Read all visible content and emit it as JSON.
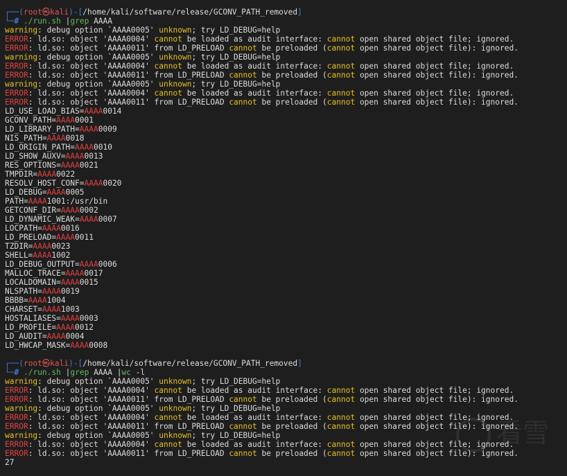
{
  "terminal": {
    "lines": [
      {
        "kind": "prompt",
        "user": "root",
        "host": "kali",
        "path": "/home/kali/software/release/GCONV_PATH_removed"
      },
      {
        "kind": "cmd",
        "segments": [
          {
            "t": "./run.sh",
            "c": "cmd"
          },
          {
            "t": " ",
            "c": "txt"
          },
          {
            "t": "|",
            "c": "pipe"
          },
          {
            "t": "grep",
            "c": "grep"
          },
          {
            "t": " AAAA",
            "c": "arg"
          }
        ]
      },
      {
        "kind": "warn",
        "segments": [
          {
            "t": "warning",
            "c": "yel"
          },
          {
            "t": ": debug option `AAAA0005' ",
            "c": "txt"
          },
          {
            "t": "unknown",
            "c": "yel"
          },
          {
            "t": "; try LD_DEBUG=help",
            "c": "txt"
          }
        ]
      },
      {
        "kind": "err",
        "segments": [
          {
            "t": "ERROR",
            "c": "err"
          },
          {
            "t": ": ld.so: object 'AAAA0004' ",
            "c": "txt"
          },
          {
            "t": "cannot",
            "c": "yel"
          },
          {
            "t": " be loaded as audit interface: ",
            "c": "txt"
          },
          {
            "t": "cannot",
            "c": "yel"
          },
          {
            "t": " open shared object file; ignored.",
            "c": "txt"
          }
        ]
      },
      {
        "kind": "err",
        "segments": [
          {
            "t": "ERROR",
            "c": "err"
          },
          {
            "t": ": ld.so: object 'AAAA0011' from LD_PRELOAD ",
            "c": "txt"
          },
          {
            "t": "cannot",
            "c": "yel"
          },
          {
            "t": " be preloaded (",
            "c": "txt"
          },
          {
            "t": "cannot",
            "c": "yel"
          },
          {
            "t": " open shared object file): ignored.",
            "c": "txt"
          }
        ]
      },
      {
        "kind": "warn",
        "segments": [
          {
            "t": "warning",
            "c": "yel"
          },
          {
            "t": ": debug option `AAAA0005' ",
            "c": "txt"
          },
          {
            "t": "unknown",
            "c": "yel"
          },
          {
            "t": "; try LD_DEBUG=help",
            "c": "txt"
          }
        ]
      },
      {
        "kind": "err",
        "segments": [
          {
            "t": "ERROR",
            "c": "err"
          },
          {
            "t": ": ld.so: object 'AAAA0004' ",
            "c": "txt"
          },
          {
            "t": "cannot",
            "c": "yel"
          },
          {
            "t": " be loaded as audit interface: ",
            "c": "txt"
          },
          {
            "t": "cannot",
            "c": "yel"
          },
          {
            "t": " open shared object file; ignored.",
            "c": "txt"
          }
        ]
      },
      {
        "kind": "err",
        "segments": [
          {
            "t": "ERROR",
            "c": "err"
          },
          {
            "t": ": ld.so: object 'AAAA0011' from LD_PRELOAD ",
            "c": "txt"
          },
          {
            "t": "cannot",
            "c": "yel"
          },
          {
            "t": " be preloaded (",
            "c": "txt"
          },
          {
            "t": "cannot",
            "c": "yel"
          },
          {
            "t": " open shared object file): ignored.",
            "c": "txt"
          }
        ]
      },
      {
        "kind": "warn",
        "segments": [
          {
            "t": "warning",
            "c": "yel"
          },
          {
            "t": ": debug option `AAAA0005' ",
            "c": "txt"
          },
          {
            "t": "unknown",
            "c": "yel"
          },
          {
            "t": "; try LD_DEBUG=help",
            "c": "txt"
          }
        ]
      },
      {
        "kind": "err",
        "segments": [
          {
            "t": "ERROR",
            "c": "err"
          },
          {
            "t": ": ld.so: object 'AAAA0004' ",
            "c": "txt"
          },
          {
            "t": "cannot",
            "c": "yel"
          },
          {
            "t": " be loaded as audit interface: ",
            "c": "txt"
          },
          {
            "t": "cannot",
            "c": "yel"
          },
          {
            "t": " open shared object file; ignored.",
            "c": "txt"
          }
        ]
      },
      {
        "kind": "err",
        "segments": [
          {
            "t": "ERROR",
            "c": "err"
          },
          {
            "t": ": ld.so: object 'AAAA0011' from LD_PRELOAD ",
            "c": "txt"
          },
          {
            "t": "cannot",
            "c": "yel"
          },
          {
            "t": " be preloaded (",
            "c": "txt"
          },
          {
            "t": "cannot",
            "c": "yel"
          },
          {
            "t": " open shared object file): ignored.",
            "c": "txt"
          }
        ]
      },
      {
        "kind": "env",
        "segments": [
          {
            "t": "LD_USE_LOAD_BIAS=",
            "c": "txt"
          },
          {
            "t": "AAAA",
            "c": "hit"
          },
          {
            "t": "0014",
            "c": "txt"
          }
        ]
      },
      {
        "kind": "env",
        "segments": [
          {
            "t": "GCONV_PATH=",
            "c": "txt"
          },
          {
            "t": "AAAA",
            "c": "hit"
          },
          {
            "t": "0001",
            "c": "txt"
          }
        ]
      },
      {
        "kind": "env",
        "segments": [
          {
            "t": "LD_LIBRARY_PATH=",
            "c": "txt"
          },
          {
            "t": "AAAA",
            "c": "hit"
          },
          {
            "t": "0009",
            "c": "txt"
          }
        ]
      },
      {
        "kind": "env",
        "segments": [
          {
            "t": "NIS_PATH=",
            "c": "txt"
          },
          {
            "t": "AAAA",
            "c": "hit"
          },
          {
            "t": "0018",
            "c": "txt"
          }
        ]
      },
      {
        "kind": "env",
        "segments": [
          {
            "t": "LD_ORIGIN_PATH=",
            "c": "txt"
          },
          {
            "t": "AAAA",
            "c": "hit"
          },
          {
            "t": "0010",
            "c": "txt"
          }
        ]
      },
      {
        "kind": "env",
        "segments": [
          {
            "t": "LD_SHOW_AUXV=",
            "c": "txt"
          },
          {
            "t": "AAAA",
            "c": "hit"
          },
          {
            "t": "0013",
            "c": "txt"
          }
        ]
      },
      {
        "kind": "env",
        "segments": [
          {
            "t": "RES_OPTIONS=",
            "c": "txt"
          },
          {
            "t": "AAAA",
            "c": "hit"
          },
          {
            "t": "0021",
            "c": "txt"
          }
        ]
      },
      {
        "kind": "env",
        "segments": [
          {
            "t": "TMPDIR=",
            "c": "txt"
          },
          {
            "t": "AAAA",
            "c": "hit"
          },
          {
            "t": "0022",
            "c": "txt"
          }
        ]
      },
      {
        "kind": "env",
        "segments": [
          {
            "t": "RESOLV_HOST_CONF=",
            "c": "txt"
          },
          {
            "t": "AAAA",
            "c": "hit"
          },
          {
            "t": "0020",
            "c": "txt"
          }
        ]
      },
      {
        "kind": "env",
        "segments": [
          {
            "t": "LD_DEBUG=",
            "c": "txt"
          },
          {
            "t": "AAAA",
            "c": "hit"
          },
          {
            "t": "0005",
            "c": "txt"
          }
        ]
      },
      {
        "kind": "env",
        "segments": [
          {
            "t": "PATH=",
            "c": "txt"
          },
          {
            "t": "AAAA",
            "c": "hit"
          },
          {
            "t": "1001:/usr/bin",
            "c": "txt"
          }
        ]
      },
      {
        "kind": "env",
        "segments": [
          {
            "t": "GETCONF_DIR=",
            "c": "txt"
          },
          {
            "t": "AAAA",
            "c": "hit"
          },
          {
            "t": "0002",
            "c": "txt"
          }
        ]
      },
      {
        "kind": "env",
        "segments": [
          {
            "t": "LD_DYNAMIC_WEAK=",
            "c": "txt"
          },
          {
            "t": "AAAA",
            "c": "hit"
          },
          {
            "t": "0007",
            "c": "txt"
          }
        ]
      },
      {
        "kind": "env",
        "segments": [
          {
            "t": "LOCPATH=",
            "c": "txt"
          },
          {
            "t": "AAAA",
            "c": "hit"
          },
          {
            "t": "0016",
            "c": "txt"
          }
        ]
      },
      {
        "kind": "env",
        "segments": [
          {
            "t": "LD_PRELOAD=",
            "c": "txt"
          },
          {
            "t": "AAAA",
            "c": "hit"
          },
          {
            "t": "0011",
            "c": "txt"
          }
        ]
      },
      {
        "kind": "env",
        "segments": [
          {
            "t": "TZDIR=",
            "c": "txt"
          },
          {
            "t": "AAAA",
            "c": "hit"
          },
          {
            "t": "0023",
            "c": "txt"
          }
        ]
      },
      {
        "kind": "env",
        "segments": [
          {
            "t": "SHELL=",
            "c": "txt"
          },
          {
            "t": "AAAA",
            "c": "hit"
          },
          {
            "t": "1002",
            "c": "txt"
          }
        ]
      },
      {
        "kind": "env",
        "segments": [
          {
            "t": "LD_DEBUG_OUTPUT=",
            "c": "txt"
          },
          {
            "t": "AAAA",
            "c": "hit"
          },
          {
            "t": "0006",
            "c": "txt"
          }
        ]
      },
      {
        "kind": "env",
        "segments": [
          {
            "t": "MALLOC_TRACE=",
            "c": "txt"
          },
          {
            "t": "AAAA",
            "c": "hit"
          },
          {
            "t": "0017",
            "c": "txt"
          }
        ]
      },
      {
        "kind": "env",
        "segments": [
          {
            "t": "LOCALDOMAIN=",
            "c": "txt"
          },
          {
            "t": "AAAA",
            "c": "hit"
          },
          {
            "t": "0015",
            "c": "txt"
          }
        ]
      },
      {
        "kind": "env",
        "segments": [
          {
            "t": "NLSPATH=",
            "c": "txt"
          },
          {
            "t": "AAAA",
            "c": "hit"
          },
          {
            "t": "0019",
            "c": "txt"
          }
        ]
      },
      {
        "kind": "env",
        "segments": [
          {
            "t": "BBBB=",
            "c": "txt"
          },
          {
            "t": "AAAA",
            "c": "hit"
          },
          {
            "t": "1004",
            "c": "txt"
          }
        ]
      },
      {
        "kind": "env",
        "segments": [
          {
            "t": "CHARSET=",
            "c": "txt"
          },
          {
            "t": "AAAA",
            "c": "hit"
          },
          {
            "t": "1003",
            "c": "txt"
          }
        ]
      },
      {
        "kind": "env",
        "segments": [
          {
            "t": "HOSTALIASES=",
            "c": "txt"
          },
          {
            "t": "AAAA",
            "c": "hit"
          },
          {
            "t": "0003",
            "c": "txt"
          }
        ]
      },
      {
        "kind": "env",
        "segments": [
          {
            "t": "LD_PROFILE=",
            "c": "txt"
          },
          {
            "t": "AAAA",
            "c": "hit"
          },
          {
            "t": "0012",
            "c": "txt"
          }
        ]
      },
      {
        "kind": "env",
        "segments": [
          {
            "t": "LD_AUDIT=",
            "c": "txt"
          },
          {
            "t": "AAAA",
            "c": "hit"
          },
          {
            "t": "0004",
            "c": "txt"
          }
        ]
      },
      {
        "kind": "env",
        "segments": [
          {
            "t": "LD_HWCAP_MASK=",
            "c": "txt"
          },
          {
            "t": "AAAA",
            "c": "hit"
          },
          {
            "t": "0008",
            "c": "txt"
          }
        ]
      },
      {
        "kind": "blank",
        "segments": []
      },
      {
        "kind": "prompt",
        "user": "root",
        "host": "kali",
        "path": "/home/kali/software/release/GCONV_PATH_removed"
      },
      {
        "kind": "cmd",
        "segments": [
          {
            "t": "./run.sh",
            "c": "cmd"
          },
          {
            "t": " ",
            "c": "txt"
          },
          {
            "t": "|",
            "c": "pipe"
          },
          {
            "t": "grep",
            "c": "grep"
          },
          {
            "t": " AAAA ",
            "c": "arg"
          },
          {
            "t": "|",
            "c": "pipe"
          },
          {
            "t": "wc",
            "c": "grep"
          },
          {
            "t": " -l",
            "c": "arg"
          }
        ]
      },
      {
        "kind": "warn",
        "segments": [
          {
            "t": "warning",
            "c": "yel"
          },
          {
            "t": ": debug option `AAAA0005' ",
            "c": "txt"
          },
          {
            "t": "unknown",
            "c": "yel"
          },
          {
            "t": "; try LD_DEBUG=help",
            "c": "txt"
          }
        ]
      },
      {
        "kind": "err",
        "segments": [
          {
            "t": "ERROR",
            "c": "err"
          },
          {
            "t": ": ld.so: object 'AAAA0004' ",
            "c": "txt"
          },
          {
            "t": "cannot",
            "c": "yel"
          },
          {
            "t": " be loaded as audit interface: ",
            "c": "txt"
          },
          {
            "t": "cannot",
            "c": "yel"
          },
          {
            "t": " open shared object file; ignored.",
            "c": "txt"
          }
        ]
      },
      {
        "kind": "err",
        "segments": [
          {
            "t": "ERROR",
            "c": "err"
          },
          {
            "t": ": ld.so: object 'AAAA0011' from LD_PRELOAD ",
            "c": "txt"
          },
          {
            "t": "cannot",
            "c": "yel"
          },
          {
            "t": " be preloaded (",
            "c": "txt"
          },
          {
            "t": "cannot",
            "c": "yel"
          },
          {
            "t": " open shared object file): ignored.",
            "c": "txt"
          }
        ]
      },
      {
        "kind": "warn",
        "segments": [
          {
            "t": "warning",
            "c": "yel"
          },
          {
            "t": ": debug option `AAAA0005' ",
            "c": "txt"
          },
          {
            "t": "unknown",
            "c": "yel"
          },
          {
            "t": "; try LD_DEBUG=help",
            "c": "txt"
          }
        ]
      },
      {
        "kind": "err",
        "segments": [
          {
            "t": "ERROR",
            "c": "err"
          },
          {
            "t": ": ld.so: object 'AAAA0004' ",
            "c": "txt"
          },
          {
            "t": "cannot",
            "c": "yel"
          },
          {
            "t": " be loaded as audit interface: ",
            "c": "txt"
          },
          {
            "t": "cannot",
            "c": "yel"
          },
          {
            "t": " open shared object file; ignored.",
            "c": "txt"
          }
        ]
      },
      {
        "kind": "err",
        "segments": [
          {
            "t": "ERROR",
            "c": "err"
          },
          {
            "t": ": ld.so: object 'AAAA0011' from LD_PRELOAD ",
            "c": "txt"
          },
          {
            "t": "cannot",
            "c": "yel"
          },
          {
            "t": " be preloaded (",
            "c": "txt"
          },
          {
            "t": "cannot",
            "c": "yel"
          },
          {
            "t": " open shared object file): ignored.",
            "c": "txt"
          }
        ]
      },
      {
        "kind": "warn",
        "segments": [
          {
            "t": "warning",
            "c": "yel"
          },
          {
            "t": ": debug option `AAAA0005' ",
            "c": "txt"
          },
          {
            "t": "unknown",
            "c": "yel"
          },
          {
            "t": "; try LD_DEBUG=help",
            "c": "txt"
          }
        ]
      },
      {
        "kind": "err",
        "segments": [
          {
            "t": "ERROR",
            "c": "err"
          },
          {
            "t": ": ld.so: object 'AAAA0004' ",
            "c": "txt"
          },
          {
            "t": "cannot",
            "c": "yel"
          },
          {
            "t": " be loaded as audit interface: ",
            "c": "txt"
          },
          {
            "t": "cannot",
            "c": "yel"
          },
          {
            "t": " open shared object file; ignored.",
            "c": "txt"
          }
        ]
      },
      {
        "kind": "err",
        "segments": [
          {
            "t": "ERROR",
            "c": "err"
          },
          {
            "t": ": ld.so: object 'AAAA0011' from LD_PRELOAD ",
            "c": "txt"
          },
          {
            "t": "cannot",
            "c": "yel"
          },
          {
            "t": " be preloaded (",
            "c": "txt"
          },
          {
            "t": "cannot",
            "c": "yel"
          },
          {
            "t": " open shared object file): ignored.",
            "c": "txt"
          }
        ]
      },
      {
        "kind": "out",
        "segments": [
          {
            "t": "27",
            "c": "txt"
          }
        ]
      }
    ]
  },
  "prompt_glyphs": {
    "top_left": "┌──",
    "bottom_left": "└─",
    "hash": "#",
    "skull": "㉿"
  },
  "watermark": {
    "icon": "kanxue-logo-icon",
    "text": "看雪"
  },
  "colors": {
    "background": "#1e1e1e",
    "text": "#dcdcdc",
    "accent": "#3d7ad6",
    "error": "#e04040",
    "warning": "#e5c020",
    "command": "#5fb85f"
  }
}
